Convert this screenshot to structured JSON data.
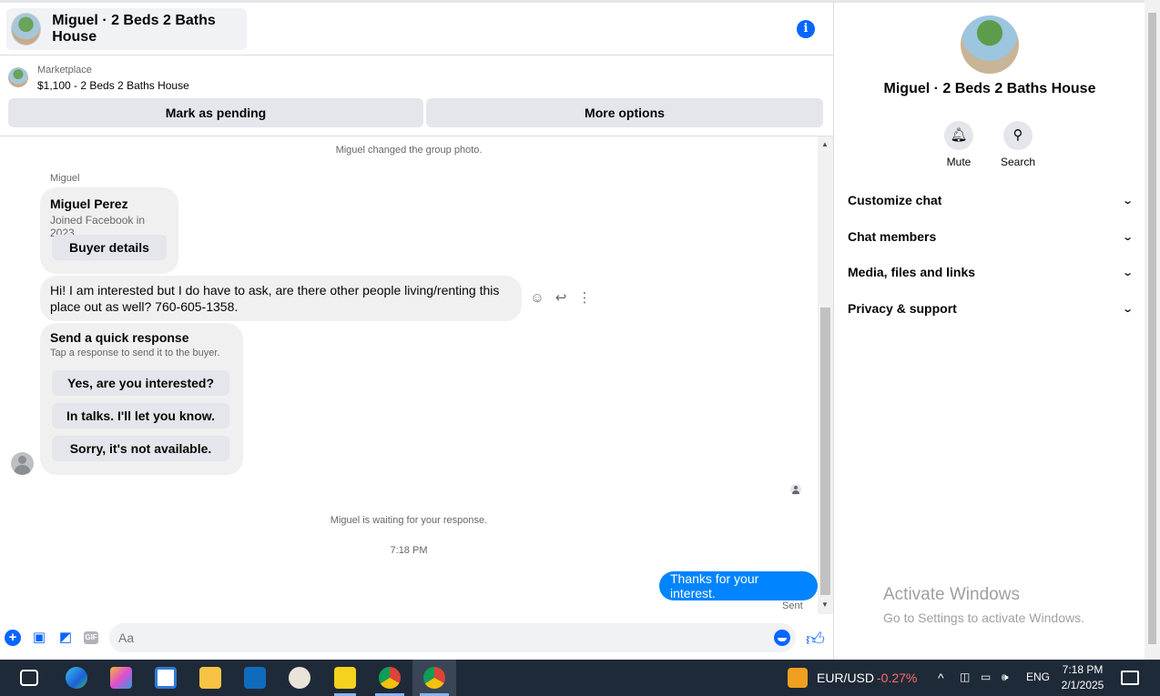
{
  "header": {
    "title": "Miguel · 2 Beds 2 Baths House",
    "info_icon": "info-icon"
  },
  "listing": {
    "category": "Marketplace",
    "title": "$1,100 - 2 Beds 2 Baths House",
    "mark_pending": "Mark as pending",
    "more_options": "More options"
  },
  "thread": {
    "group_photo_notice": "Miguel changed the group photo.",
    "sender_label": "Miguel",
    "profile_card": {
      "name": "Miguel Perez",
      "joined": "Joined Facebook in 2023",
      "button": "Buyer details"
    },
    "message": "Hi! I am interested but I do have to ask, are there other people living/renting this place out as well? 760-605-1358.",
    "quick_response": {
      "title": "Send a quick response",
      "subtitle": "Tap a response to send it to the buyer.",
      "options": [
        "Yes, are you interested?",
        "In talks. I'll let you know.",
        "Sorry, it's not available."
      ]
    },
    "waiting_notice": "Miguel is waiting for your response.",
    "timestamp": "7:18 PM",
    "outgoing": "Thanks for your interest.",
    "status": "Sent"
  },
  "composer": {
    "placeholder": "Aa",
    "gif_label": "GIF"
  },
  "side": {
    "title": "Miguel · 2 Beds 2 Baths House",
    "mute": "Mute",
    "search": "Search",
    "sections": [
      "Customize chat",
      "Chat members",
      "Media, files and links",
      "Privacy & support"
    ]
  },
  "watermark": {
    "line1": "Activate Windows",
    "line2": "Go to Settings to activate Windows."
  },
  "taskbar": {
    "ticker": "EUR/USD",
    "ticker_change": "-0.27%",
    "lang": "ENG",
    "time": "7:18 PM",
    "date": "2/1/2025"
  }
}
